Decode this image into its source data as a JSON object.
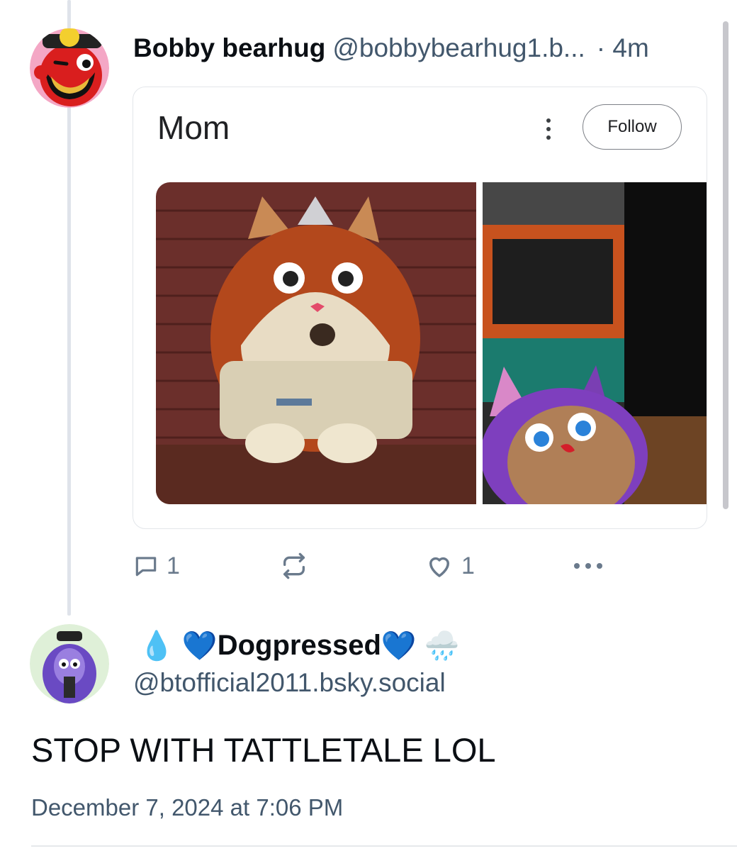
{
  "reply": {
    "author_name": "Bobby bearhug",
    "author_handle": "@bobbybearhug1.b...",
    "time": "· 4m",
    "avatar_icon": "red-cartoon-bear-avatar",
    "embed": {
      "title": "Mom",
      "follow_label": "Follow",
      "menu_icon": "kebab-menu-icon",
      "images": [
        "tattletail-mama-character",
        "tattletail-purple-character"
      ]
    },
    "actions": {
      "reply_icon": "comment-icon",
      "reply_count": "1",
      "repost_icon": "repost-icon",
      "like_icon": "heart-icon",
      "like_count": "1",
      "more_icon": "more-horizontal-icon"
    }
  },
  "original_post": {
    "avatar_icon": "purple-dog-character-avatar",
    "display_name_prefix_emoji": "💧 💙",
    "display_name": "Dogpressed",
    "display_name_suffix_emoji": "💙 🌧️",
    "handle": "@btofficial2011.bsky.social",
    "text": "STOP WITH TATTLETALE LOL",
    "timestamp": "December 7, 2024 at 7:06 PM"
  },
  "colors": {
    "secondary_text": "#42576c",
    "icon_gray": "#6a7a8c",
    "thread_line": "#dfe3ea",
    "heart_blue": "#1d6cf0"
  }
}
